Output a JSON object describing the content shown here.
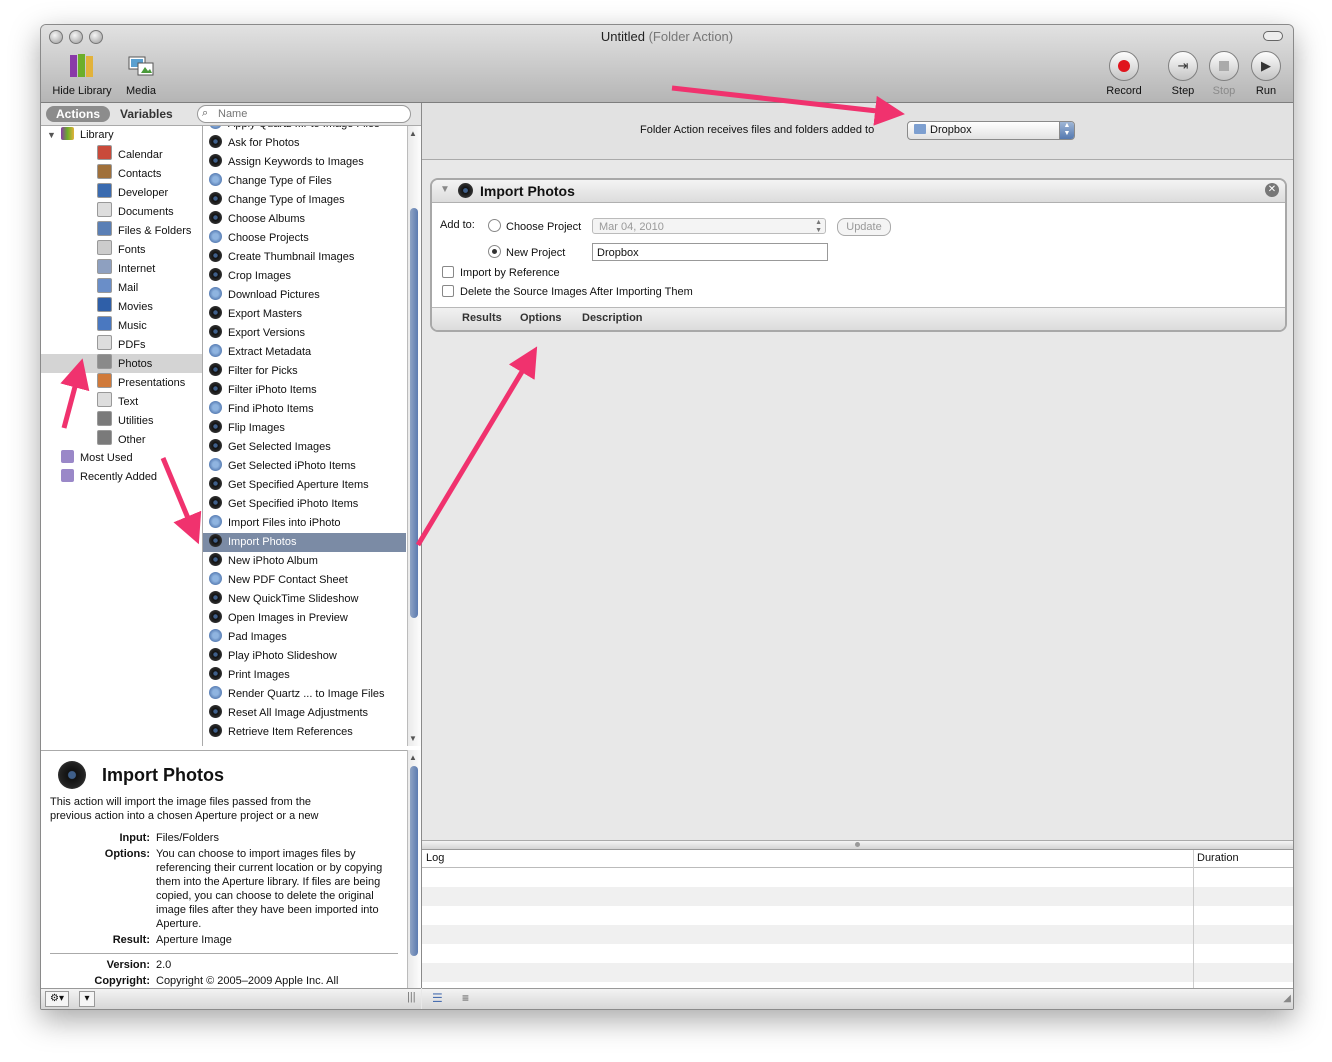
{
  "window": {
    "title": "Untitled",
    "subtitle": "(Folder Action)"
  },
  "toolbar": {
    "hide_library": "Hide Library",
    "media": "Media",
    "record": "Record",
    "step": "Step",
    "stop": "Stop",
    "run": "Run"
  },
  "left": {
    "tabs": [
      "Actions",
      "Variables"
    ],
    "search_placeholder": "Name",
    "library_root": "Library",
    "library": [
      {
        "label": "Calendar",
        "icon": "calendar-icon",
        "color": "#c94a3a"
      },
      {
        "label": "Contacts",
        "icon": "contacts-icon",
        "color": "#a0703a"
      },
      {
        "label": "Developer",
        "icon": "developer-icon",
        "color": "#3a6bb0"
      },
      {
        "label": "Documents",
        "icon": "documents-icon",
        "color": "#dddddd"
      },
      {
        "label": "Files & Folders",
        "icon": "files-folders-icon",
        "color": "#5a7fb5"
      },
      {
        "label": "Fonts",
        "icon": "fonts-icon",
        "color": "#cccccc"
      },
      {
        "label": "Internet",
        "icon": "internet-icon",
        "color": "#8ea0c0"
      },
      {
        "label": "Mail",
        "icon": "mail-icon",
        "color": "#6a8ec8"
      },
      {
        "label": "Movies",
        "icon": "movies-icon",
        "color": "#2f5fa8"
      },
      {
        "label": "Music",
        "icon": "music-icon",
        "color": "#4a78c0"
      },
      {
        "label": "PDFs",
        "icon": "pdf-icon",
        "color": "#dddddd"
      },
      {
        "label": "Photos",
        "icon": "photos-icon",
        "color": "#8a8a8a"
      },
      {
        "label": "Presentations",
        "icon": "presentations-icon",
        "color": "#d07a3a"
      },
      {
        "label": "Text",
        "icon": "text-icon",
        "color": "#dddddd"
      },
      {
        "label": "Utilities",
        "icon": "utilities-icon",
        "color": "#7a7a7a"
      },
      {
        "label": "Other",
        "icon": "other-icon",
        "color": "#7a7a7a"
      }
    ],
    "smart_groups": [
      "Most Used",
      "Recently Added"
    ],
    "actions": [
      "Apply Quartz ...r to Image Files",
      "Ask for Photos",
      "Assign Keywords to Images",
      "Change Type of Files",
      "Change Type of Images",
      "Choose Albums",
      "Choose Projects",
      "Create Thumbnail Images",
      "Crop Images",
      "Download Pictures",
      "Export Masters",
      "Export Versions",
      "Extract Metadata",
      "Filter for Picks",
      "Filter iPhoto Items",
      "Find iPhoto Items",
      "Flip Images",
      "Get Selected Images",
      "Get Selected iPhoto Items",
      "Get Specified Aperture Items",
      "Get Specified iPhoto Items",
      "Import Files into iPhoto",
      "Import Photos",
      "New iPhoto Album",
      "New PDF Contact Sheet",
      "New QuickTime Slideshow",
      "Open Images in Preview",
      "Pad Images",
      "Play iPhoto Slideshow",
      "Print Images",
      "Render Quartz ... to Image Files",
      "Reset All Image Adjustments",
      "Retrieve Item References"
    ],
    "description": {
      "title": "Import Photos",
      "text": "This action will import the image files passed from the previous action into a chosen Aperture project or a new",
      "input_label": "Input:",
      "input": "Files/Folders",
      "options_label": "Options:",
      "options": "You can choose to import images files by referencing their current location or by copying them into the Aperture library. If files are being copied, you can choose to delete the original image files after they have been imported into Aperture.",
      "result_label": "Result:",
      "result": "Aperture Image",
      "version_label": "Version:",
      "version": "2.0",
      "copyright_label": "Copyright:",
      "copyright": "Copyright © 2005–2009 Apple Inc. All"
    }
  },
  "workflow": {
    "receives_label": "Folder Action receives files and folders added to",
    "folder": "Dropbox",
    "action": {
      "title": "Import Photos",
      "add_to_label": "Add to:",
      "choose_project": "Choose Project",
      "project_date": "Mar 04, 2010",
      "update": "Update",
      "new_project": "New Project",
      "new_project_name": "Dropbox",
      "import_by_reference": "Import by Reference",
      "delete_source": "Delete the Source Images After Importing Them",
      "footer": [
        "Results",
        "Options",
        "Description"
      ]
    },
    "log": {
      "log_label": "Log",
      "duration_label": "Duration"
    }
  },
  "colors": {
    "annotation_arrow": "#f0326e",
    "selection": "#7b8ba5",
    "record": "#e0141c"
  }
}
